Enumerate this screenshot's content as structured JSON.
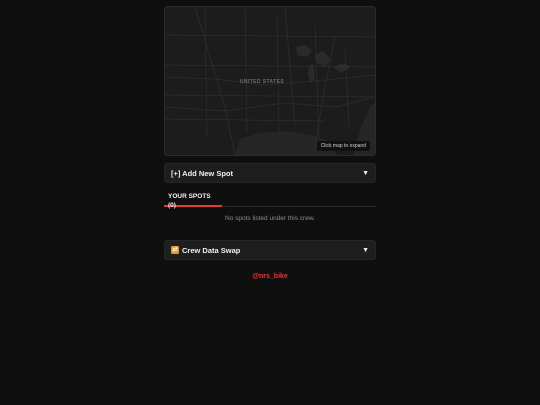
{
  "map": {
    "country_label": "UNITED STATES",
    "expand_hint": "Click map to expand",
    "colors": {
      "land": "#1c1c1c",
      "water": "#2a2a2a",
      "roads": "#262626",
      "borders": "#3a3a3a"
    }
  },
  "add_spot": {
    "label": "[+] Add New Spot",
    "chevron": "▼"
  },
  "spots": {
    "tab_label": "YOUR SPOTS (0)",
    "empty_message": "No spots listed under this crew."
  },
  "crew_swap": {
    "icon": "swap-icon",
    "label": "Crew Data Swap",
    "chevron": "▼"
  },
  "footer": {
    "handle": "@nrs_bike"
  },
  "theme": {
    "accent": "#e53935",
    "background": "#0f0f0f",
    "panel": "#1e1e1e"
  }
}
